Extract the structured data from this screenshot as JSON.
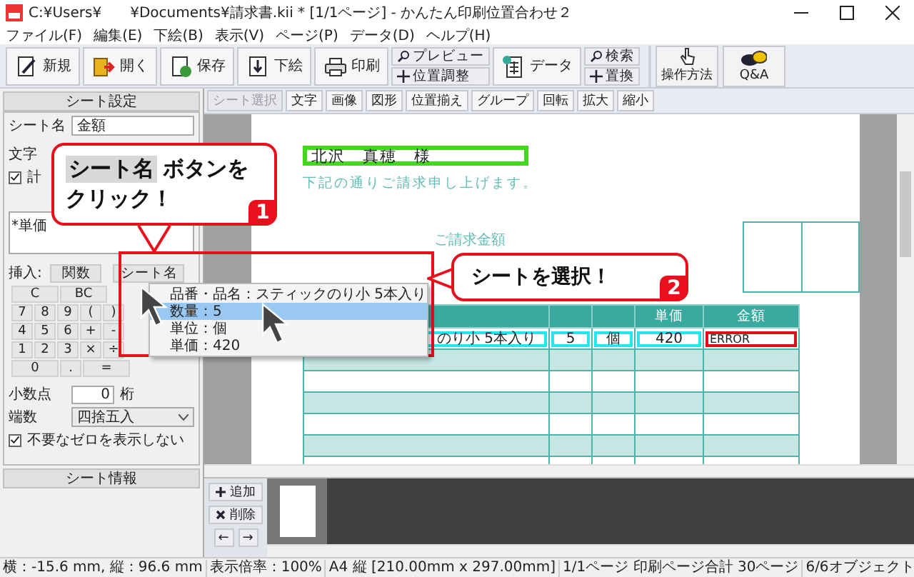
{
  "window": {
    "title": "C:¥Users¥　　¥Documents¥請求書.kii *  [1/1ページ] - かんたん印刷位置合わせ２"
  },
  "menu": [
    "ファイル(F)",
    "編集(E)",
    "下絵(B)",
    "表示(V)",
    "ページ(P)",
    "データ(D)",
    "ヘルプ(H)"
  ],
  "toolbar": [
    {
      "kind": "large",
      "label": "新規"
    },
    {
      "kind": "large",
      "label": "開く"
    },
    {
      "kind": "large",
      "label": "保存"
    },
    {
      "kind": "large",
      "label": "下絵"
    },
    {
      "kind": "large",
      "label": "印刷"
    },
    {
      "kind": "pair",
      "items": [
        "プレビュー",
        "位置調整"
      ]
    },
    {
      "kind": "large",
      "label": "データ"
    },
    {
      "kind": "pair",
      "items": [
        "検索",
        "置換"
      ]
    },
    {
      "kind": "help",
      "label": "操作方法"
    },
    {
      "kind": "help",
      "label": "Q&A"
    }
  ],
  "sheet_settings": {
    "header": "シート設定",
    "name_label": "シート名",
    "name_value": "金額",
    "tab_label": "文字",
    "calc_checkbox": {
      "label": "計",
      "checked": true
    },
    "formula": "*単価",
    "insert_label": "挿入:",
    "function_button": "関数",
    "sheet_name_button": "シート名",
    "keys": [
      [
        "C",
        "BC"
      ],
      [
        "7",
        "8",
        "9",
        "(",
        ")"
      ],
      [
        "4",
        "5",
        "6",
        "+",
        "-"
      ],
      [
        "1",
        "2",
        "3",
        "×",
        "÷"
      ],
      [
        "0",
        ".",
        "="
      ]
    ],
    "decimal_label": "小数点",
    "decimal_value": "0",
    "decimal_unit": "桁",
    "rounding_label": "端数",
    "rounding_value": "四捨五入",
    "hide_zero": {
      "label": "不要なゼロを表示しない",
      "checked": true
    }
  },
  "sheet_info": {
    "header": "シート情報"
  },
  "object_toolbar": [
    {
      "label": "シート選択",
      "disabled": true
    },
    {
      "label": "文字",
      "disabled": false
    },
    {
      "label": "画像",
      "disabled": false
    },
    {
      "label": "図形",
      "disabled": false
    },
    {
      "label": "位置揃え",
      "disabled": false
    },
    {
      "label": "グループ",
      "disabled": false
    },
    {
      "label": "回転",
      "disabled": false
    },
    {
      "label": "拡大",
      "disabled": false
    },
    {
      "label": "縮小",
      "disabled": false
    }
  ],
  "document": {
    "recipient": "北沢　真穂　様",
    "note": "下記の通りご請求申し上げます。",
    "amount_label": "ご請求金額",
    "table": {
      "header": {
        "unit_price": "単価",
        "amount": "金額"
      },
      "rows": [
        {
          "name": "のり小 5本入り",
          "quantity": "5",
          "unit": "個",
          "unit_price": "420",
          "amount": "ERROR",
          "selected": true
        }
      ]
    }
  },
  "pages": {
    "buttons": [
      "追加",
      "削除"
    ],
    "arrows": [
      "←",
      "→"
    ]
  },
  "sheet_menu": {
    "items": [
      {
        "label": "品番・品名：スティックのり小 5本入り",
        "selected": false
      },
      {
        "label": "数量：5",
        "selected": true
      },
      {
        "label": "単位：個",
        "selected": false
      },
      {
        "label": "単価：420",
        "selected": false
      }
    ]
  },
  "callouts": [
    {
      "badge": "1",
      "highlight": "シート名",
      "text": "ボタンを",
      "line2": "クリック！"
    },
    {
      "badge": "2",
      "text": "シートを選択！"
    }
  ],
  "status_bar": [
    "横：-15.6 mm, 縦：96.6 mm",
    "表示倍率：100%",
    "A4 縦 [210.00mm x 297.00mm]",
    "1/1ページ 印刷ページ合計 30ページ",
    "6/6オブジェクト"
  ]
}
